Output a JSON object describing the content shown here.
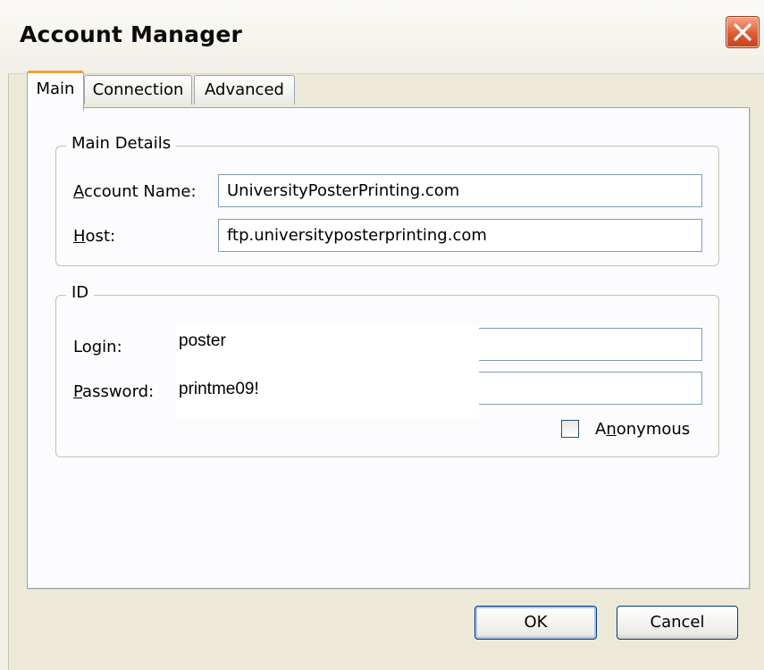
{
  "window": {
    "title": "Account Manager",
    "close_icon": "close-icon"
  },
  "tabs": [
    {
      "label": "Main",
      "active": true
    },
    {
      "label": "Connection",
      "active": false
    },
    {
      "label": "Advanced",
      "active": false
    }
  ],
  "main_details": {
    "legend": "Main Details",
    "account_name_label_pre": "A",
    "account_name_label_rest": "ccount Name:",
    "account_name_value": "UniversityPosterPrinting.com",
    "host_label_pre": "H",
    "host_label_rest": "ost:",
    "host_value": "ftp.universityposterprinting.com"
  },
  "id_group": {
    "legend": "ID",
    "login_label_pre": "Lo",
    "login_label_u": "g",
    "login_label_rest": "in:",
    "login_value": "poster",
    "password_label_pre": "P",
    "password_label_rest": "assword:",
    "password_value": "printme09!",
    "anonymous_label_pre": "A",
    "anonymous_label_u": "n",
    "anonymous_label_rest": "onymous",
    "anonymous_checked": false
  },
  "buttons": {
    "ok": "OK",
    "cancel": "Cancel"
  },
  "colors": {
    "accent_tab": "#e8a33c",
    "close_button": "#df5b33",
    "field_border": "#7f9db9"
  }
}
